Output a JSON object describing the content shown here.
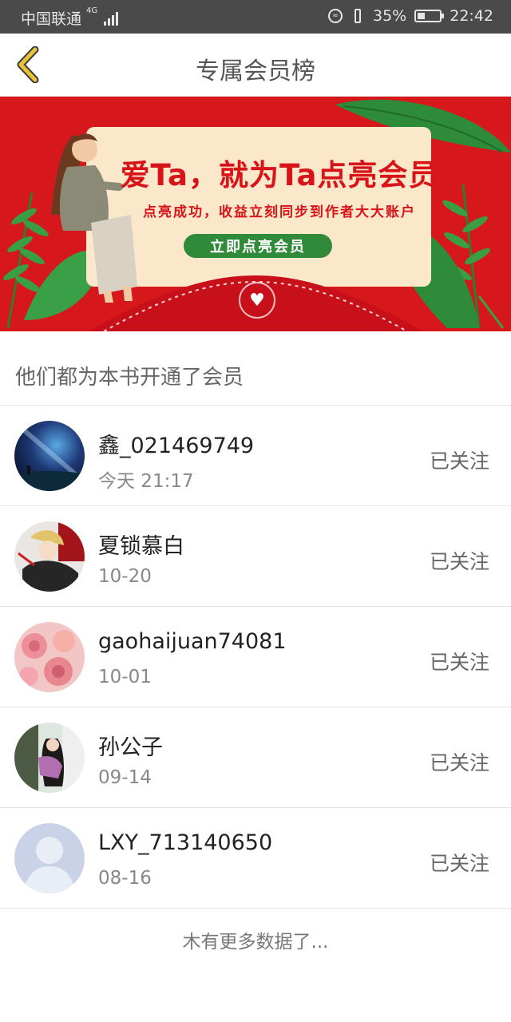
{
  "status_bar": {
    "carrier": "中国联通",
    "network": "4G",
    "battery": "35%",
    "battery_level": 0.35,
    "time": "22:42"
  },
  "header": {
    "title": "专属会员榜",
    "back_icon": "chevron-left-icon"
  },
  "banner": {
    "title": "爱Ta，就为Ta点亮会员",
    "subtitle": "点亮成功，收益立刻同步到作者大大账户",
    "button": "立即点亮会员"
  },
  "section": {
    "title": "他们都为本书开通了会员"
  },
  "members": [
    {
      "name": "鑫_021469749",
      "date": "今天 21:17",
      "follow": "已关注"
    },
    {
      "name": "夏锁慕白",
      "date": "10-20",
      "follow": "已关注"
    },
    {
      "name": "gaohaijuan74081",
      "date": "10-01",
      "follow": "已关注"
    },
    {
      "name": "孙公子",
      "date": "09-14",
      "follow": "已关注"
    },
    {
      "name": "LXY_713140650",
      "date": "08-16",
      "follow": "已关注"
    }
  ],
  "footer": {
    "more_text": "木有更多数据了..."
  },
  "colors": {
    "banner_red": "#d6171b",
    "card_cream": "#fbe7c9",
    "button_green": "#2f8a3a",
    "back_yellow": "#e7c23a"
  }
}
